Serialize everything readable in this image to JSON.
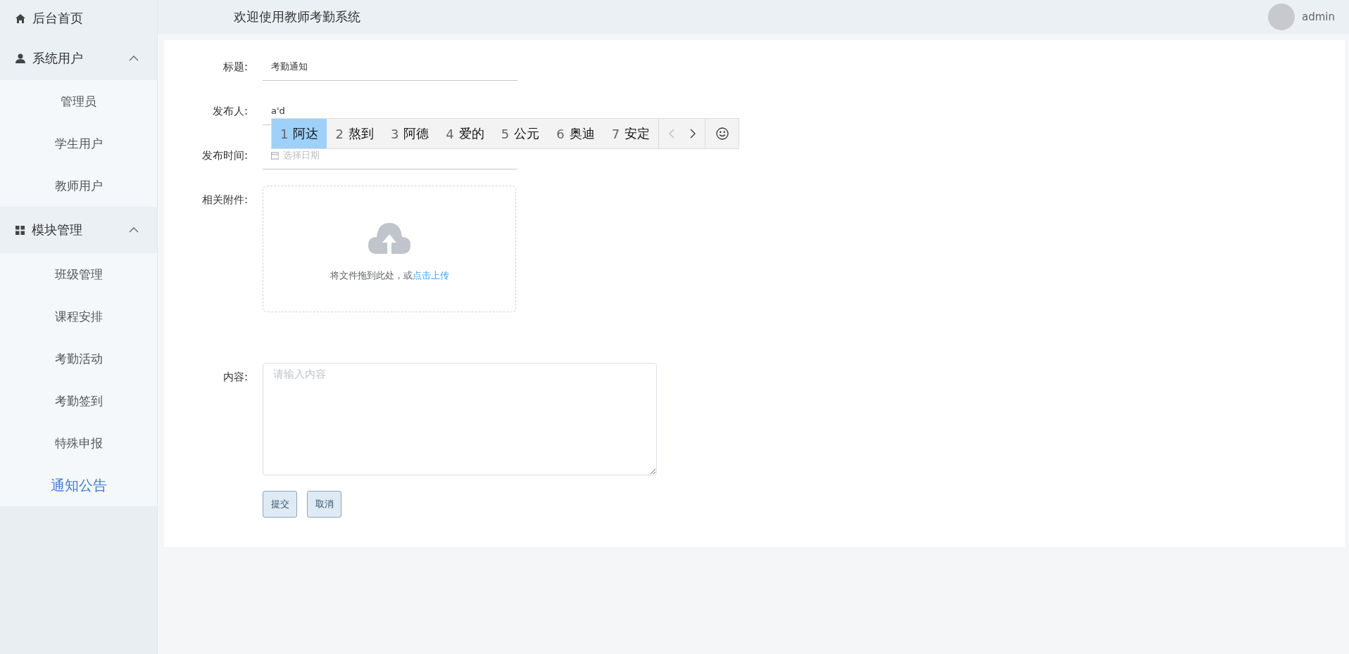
{
  "header": {
    "title": "欢迎使用教师考勤系统",
    "user": {
      "name": "admin"
    }
  },
  "sidebar": {
    "items": [
      {
        "kind": "link",
        "label": "后台首页"
      },
      {
        "kind": "group",
        "label": "系统用户",
        "expanded": true,
        "children": [
          {
            "label": "管理员",
            "selected": false
          },
          {
            "label": "学生用户",
            "selected": false
          },
          {
            "label": "教师用户",
            "selected": false
          }
        ]
      },
      {
        "kind": "group",
        "label": "模块管理",
        "expanded": true,
        "children": [
          {
            "label": "班级管理",
            "selected": false
          },
          {
            "label": "课程安排",
            "selected": false
          },
          {
            "label": "考勤活动",
            "selected": false
          },
          {
            "label": "考勤签到",
            "selected": false
          },
          {
            "label": "特殊申报",
            "selected": false
          },
          {
            "label": "通知公告",
            "selected": true
          }
        ]
      }
    ]
  },
  "form": {
    "fields": [
      {
        "kind": "text",
        "label": "标题:",
        "value": "考勤通知"
      },
      {
        "kind": "text",
        "label": "发布人:",
        "value": "a'd"
      },
      {
        "kind": "date",
        "label": "发布时间:",
        "placeholder": "选择日期"
      },
      {
        "kind": "upload",
        "label": "相关附件:",
        "hint": "将文件拖到此处，或",
        "link": "点击上传"
      },
      {
        "kind": "textarea",
        "label": "内容:",
        "placeholder": "请输入内容"
      }
    ],
    "buttons": [
      "提交",
      "取消"
    ]
  },
  "ime": {
    "candidates": [
      {
        "number": "1",
        "text": "阿达",
        "selected": true
      },
      {
        "number": "2",
        "text": "熬到",
        "selected": false
      },
      {
        "number": "3",
        "text": "阿德",
        "selected": false
      },
      {
        "number": "4",
        "text": "爱的",
        "selected": false
      },
      {
        "number": "5",
        "text": "公元",
        "selected": false
      },
      {
        "number": "6",
        "text": "奥迪",
        "selected": false
      },
      {
        "number": "7",
        "text": "安定",
        "selected": false
      }
    ]
  }
}
